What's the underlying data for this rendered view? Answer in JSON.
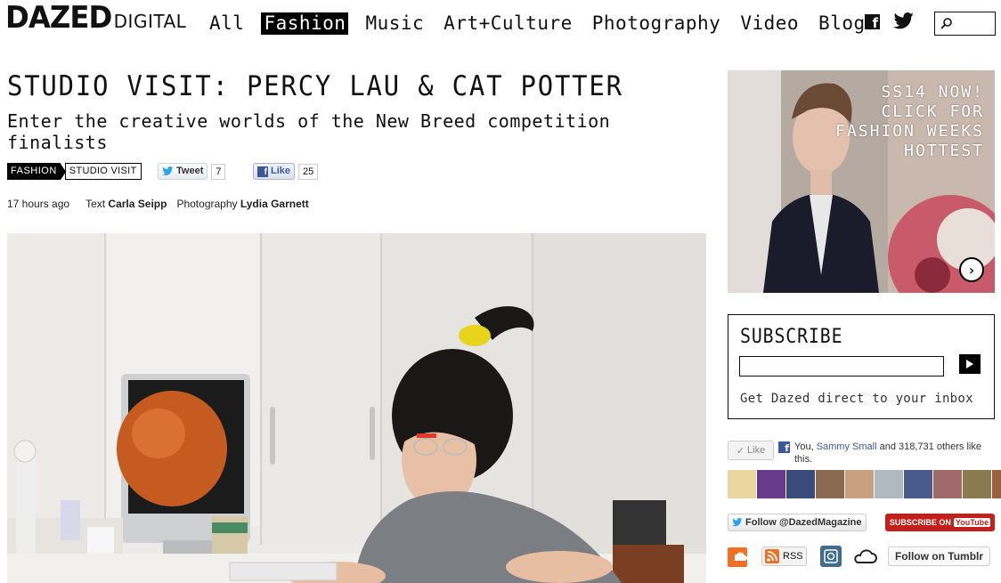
{
  "brand": {
    "logo_main": "DAZED",
    "logo_sub": "DIGITAL"
  },
  "nav": {
    "items": [
      {
        "label": "All",
        "active": false
      },
      {
        "label": "Fashion",
        "active": true
      },
      {
        "label": "Music",
        "active": false
      },
      {
        "label": "Art+Culture",
        "active": false
      },
      {
        "label": "Photography",
        "active": false
      },
      {
        "label": "Video",
        "active": false
      },
      {
        "label": "Blogs",
        "active": false
      }
    ]
  },
  "header_icons": {
    "facebook": "facebook-icon",
    "twitter": "twitter-icon",
    "search": "search-icon"
  },
  "article": {
    "title": "STUDIO VISIT: PERCY LAU & CAT POTTER",
    "subtitle": "Enter the creative worlds of the New Breed competition finalists",
    "tags": [
      "FASHION",
      "STUDIO VISIT"
    ],
    "tweet_label": "Tweet",
    "tweet_count": "7",
    "like_label": "Like",
    "like_count": "25",
    "time_ago": "17 hours ago",
    "text_label": "Text",
    "text_author": "Carla Seipp",
    "photo_label": "Photography",
    "photo_author": "Lydia Garnett"
  },
  "sidebar": {
    "ad": {
      "lines": [
        "SS14 NOW!",
        "CLICK FOR",
        "FASHION WEEKS",
        "HOTTEST"
      ]
    },
    "subscribe": {
      "heading": "SUBSCRIBE",
      "input_placeholder": "",
      "note": "Get Dazed direct to your inbox"
    },
    "facebook": {
      "like_label": "Like",
      "text_prefix": "You,",
      "friend": "Sammy Small",
      "text_suffix": "and 318,731 others like this."
    },
    "twitter_follow": "Follow @DazedMagazine",
    "youtube": {
      "label": "SUBSCRIBE ON",
      "logo": "YouTube"
    },
    "rss_label": "RSS",
    "tumblr_label": "Follow on Tumblr"
  },
  "colors": {
    "accent": "#000000",
    "facebook": "#3b5998",
    "youtube": "#c3201b",
    "rss": "#f26f23"
  }
}
